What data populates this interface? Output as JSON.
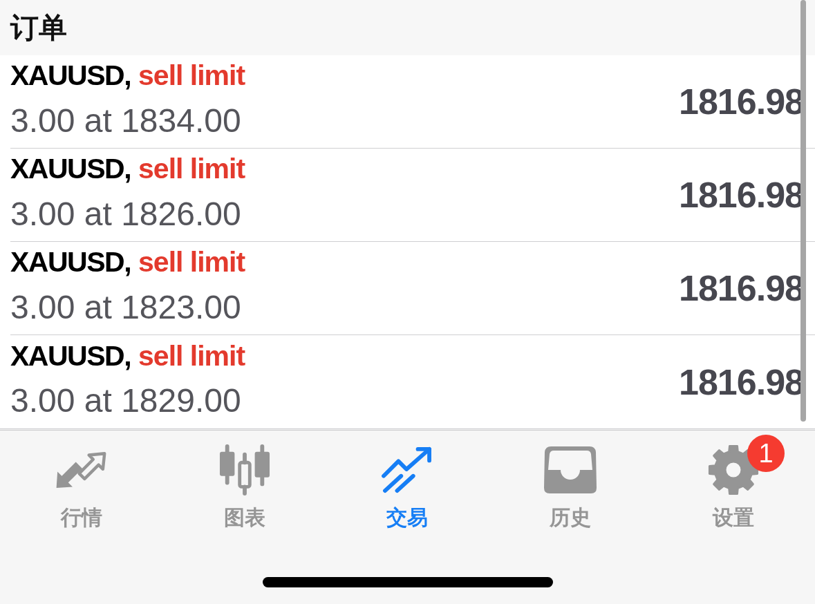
{
  "header": {
    "title": "订单"
  },
  "orders": [
    {
      "symbol": "XAUUSD,",
      "type": "sell limit",
      "color": "#e33a2d",
      "details": "3.00 at 1834.00",
      "price": "1816.98"
    },
    {
      "symbol": "XAUUSD,",
      "type": "sell limit",
      "color": "#e33a2d",
      "details": "3.00 at 1826.00",
      "price": "1816.98"
    },
    {
      "symbol": "XAUUSD,",
      "type": "sell limit",
      "color": "#e33a2d",
      "details": "3.00 at 1823.00",
      "price": "1816.98"
    },
    {
      "symbol": "XAUUSD,",
      "type": "sell limit",
      "color": "#e33a2d",
      "details": "3.00 at 1829.00",
      "price": "1816.98"
    }
  ],
  "tab_bar": {
    "tabs": [
      {
        "label": "行情",
        "selected": false
      },
      {
        "label": "图表",
        "selected": false
      },
      {
        "label": "交易",
        "selected": true
      },
      {
        "label": "历史",
        "selected": false
      },
      {
        "label": "设置",
        "selected": false,
        "badge": "1"
      }
    ]
  }
}
